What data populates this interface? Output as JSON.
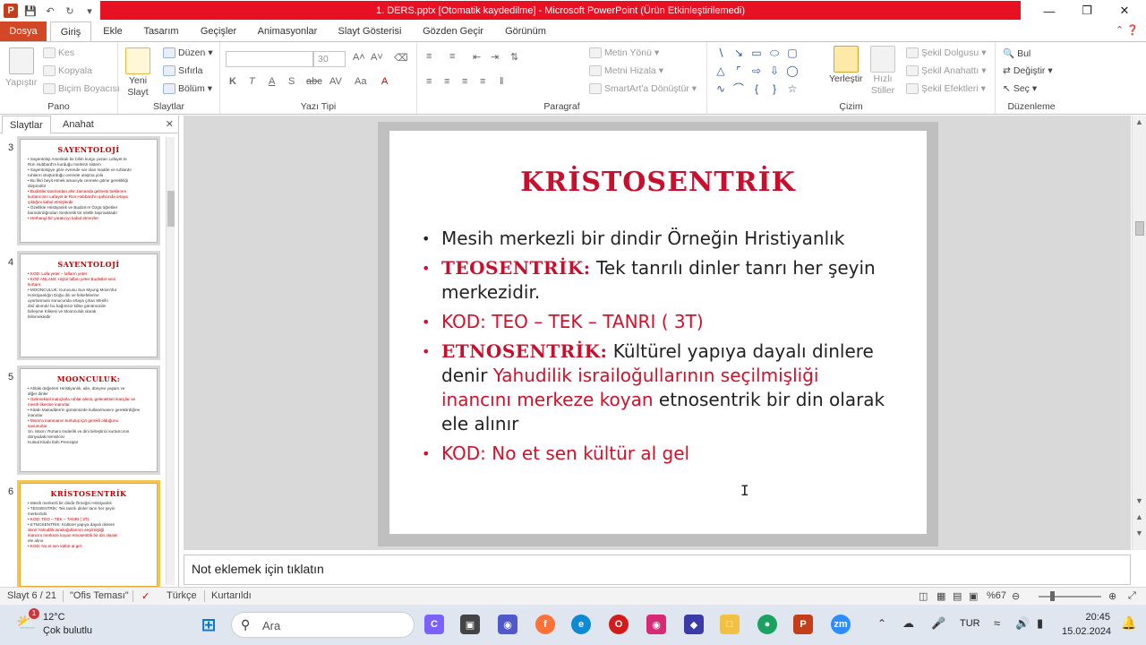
{
  "window": {
    "title": "1. DERS.pptx [Otomatik kaydedilme] - Microsoft PowerPoint (Ürün Etkinleştirilemedi)",
    "title_bar_color": "#e81123"
  },
  "ribbon_tabs": [
    "Dosya",
    "Giriş",
    "Ekle",
    "Tasarım",
    "Geçişler",
    "Animasyonlar",
    "Slayt Gösterisi",
    "Gözden Geçir",
    "Görünüm"
  ],
  "ribbon": {
    "pano": {
      "label": "Pano",
      "yapistir": "Yapıştır",
      "kes": "Kes",
      "kopyala": "Kopyala",
      "bicim": "Biçim Boyacısı"
    },
    "slaytlar": {
      "label": "Slaytlar",
      "yeni": "Yeni",
      "slayt": "Slayt",
      "duzen": "Düzen",
      "sifirla": "Sıfırla",
      "bolum": "Bölüm"
    },
    "yazi": {
      "label": "Yazı Tipi",
      "font_placeholder": "",
      "size": "30"
    },
    "paragraf": {
      "label": "Paragraf",
      "metin_yonu": "Metin Yönü",
      "metni_hizala": "Metni Hizala",
      "smartart": "SmartArt'a Dönüştür"
    },
    "cizim": {
      "label": "Çizim",
      "yerlestir": "Yerleştir",
      "hizli": "Hızlı",
      "stiller": "Stiller",
      "dolgu": "Şekil Dolgusu",
      "anahat": "Şekil Anahattı",
      "efekt": "Şekil Efektleri"
    },
    "duzenleme": {
      "label": "Düzenleme",
      "bul": "Bul",
      "degistir": "Değiştir",
      "sec": "Seç"
    }
  },
  "left_panel": {
    "tabs": [
      "Slaytlar",
      "Anahat"
    ],
    "slides": [
      {
        "num": "3",
        "title": "SAYENTOLOJİ",
        "lines": [
          {
            "t": "• Sayentoloji Amerikalı bir bilim kurgu yazarı Lafayet te",
            "red": false
          },
          {
            "t": "  Ron Hubbard'ın kurduğu merkezi sistem",
            "red": false
          },
          {
            "t": "• Sayentolojiye göre evrende var olan madde ve ruhlardır",
            "red": false
          },
          {
            "t": "  ruhların oluşturduğu cennete ulaşma yolu",
            "red": false
          },
          {
            "t": "• Bu fikri beyit etmek amacıyla cennete gitme gerekliliği",
            "red": false
          },
          {
            "t": "  düşünülür",
            "red": false
          },
          {
            "t": "• Budistler tanrılardan ahir zamanda gelmesi beklenen",
            "red": true
          },
          {
            "t": "  kurtarıcının Lafayet te Ron Hubbard'ın şahsında ortaya",
            "red": true
          },
          {
            "t": "  çıktığını kabul etmişlerdir",
            "red": true
          },
          {
            "t": "• Özellikle Hristiyanlık ve Budizm'e Özgü öğretiler",
            "red": false
          },
          {
            "t": "  barındırdığından Senkretik bir nitelik taşımaktadır",
            "red": false
          },
          {
            "t": "• Herhangi bir yaratıcıyı kabul etmezler",
            "red": true
          }
        ]
      },
      {
        "num": "4",
        "title": "SAYENTOLOJİ",
        "lines": [
          {
            "t": "• KOD: Lafa yeter – lafların yeter",
            "red": true
          },
          {
            "t": "• KOD ANLAMI: Hiçbir lafları yeter Budistler seni",
            "red": true
          },
          {
            "t": "  kurtarır",
            "red": true
          },
          {
            "t": "• MOONCULUK: Kurucusu Sun Myung Moon'dur",
            "red": false
          },
          {
            "t": "  Hıristiyanlığın Doğu din ve felsefelerine",
            "red": false
          },
          {
            "t": "  uyarlanması sonucunda ortaya çıkan Mesihi",
            "red": false
          },
          {
            "t": "  dinî akımdır bu bağımsız kilise günümüzde",
            "red": false
          },
          {
            "t": "  birleşme Kilisesi ve Moonculuk olarak",
            "red": false
          },
          {
            "t": "  bilinmektedir",
            "red": false
          }
        ]
      },
      {
        "num": "5",
        "title": "MOONCULUK:",
        "lines": [
          {
            "t": "• Ahlaki değerleri Hıristiyanlık, aile, dünyevi yaşam ve",
            "red": false
          },
          {
            "t": "  diğer dinler",
            "red": false
          },
          {
            "t": "• Geleneksel inançlarla ruhlar alemi, geleneksel inançlar ve",
            "red": true
          },
          {
            "t": "  mesih ilkesine inanırlar",
            "red": true
          },
          {
            "t": "• Kitabı Mukaddes'in günümüzde kullanılmasını gerektirdiğine",
            "red": false
          },
          {
            "t": "  inanırlar",
            "red": false
          },
          {
            "t": "• Moon'a inanmanın kurtuluş için gerekli olduğunu",
            "red": true
          },
          {
            "t": "  savunurlar",
            "red": true
          },
          {
            "t": "  Sn. Moon: Ruhani önderlik ve dini birleştirici kurtarıcının",
            "red": false
          },
          {
            "t": "  dünyadaki temsilcisi",
            "red": false
          },
          {
            "t": "  Kutsal Kitabı İlahi Prensiptir",
            "red": false
          }
        ]
      },
      {
        "num": "6",
        "title": "KRİSTOSENTRİK",
        "lines": [
          {
            "t": "• Mesih merkezli bir dindir Örneğin Hristiyanlık",
            "red": false
          },
          {
            "t": "• TEOSENTRİK: Tek tanrılı dinler tanrı her şeyin",
            "red": false
          },
          {
            "t": "  merkezidir.",
            "red": false
          },
          {
            "t": "• KOD: TEO – TEK – TANRI ( 3T)",
            "red": true
          },
          {
            "t": "• ETNOSENTRİK: Kültürel yapıya dayalı dinlere",
            "red": false
          },
          {
            "t": "  denir Yahudilik israiloğullarının seçilmişliği",
            "red": true
          },
          {
            "t": "  inancını merkeze koyan etnosentrik bir din olarak",
            "red": true
          },
          {
            "t": "  ele alınır",
            "red": false
          },
          {
            "t": "• KOD: No et sen kültür al gel",
            "red": true
          }
        ]
      }
    ]
  },
  "slide": {
    "title": "KRİSTOSENTRİK",
    "b1": "Mesih merkezli bir dindir Örneğin Hristiyanlık",
    "b2_term": "TEOSENTRİK:",
    "b2_rest_1": " Tek tanrılı dinler tanrı her şeyin",
    "b2_rest_2": "merkezidir.",
    "b3": "KOD: TEO – TEK – TANRI ( 3T)",
    "b4_term": "ETNOSENTRİK:",
    "b4_rest_1": " Kültürel yapıya dayalı dinlere",
    "b4_denir": "denir ",
    "b4_red_1": "Yahudilik israiloğullarının seçilmişliği",
    "b4_red_2": "inancını merkeze koyan",
    "b4_rest_2": " etnosentrik bir din olarak",
    "b4_rest_3": "ele alınır",
    "b5": "KOD: No et sen kültür al gel",
    "accent_color": "#c8102e"
  },
  "notes": {
    "placeholder": "Not eklemek için tıklatın"
  },
  "status": {
    "slide": "Slayt 6 / 21",
    "theme": "\"Ofis Teması\"",
    "lang": "Türkçe",
    "saved": "Kurtarıldı",
    "zoom": "%67"
  },
  "taskbar": {
    "temp": "12°C",
    "weather": "Çok bulutlu",
    "search": "Ara",
    "lang": "TUR",
    "time": "20:45",
    "date": "15.02.2024",
    "weather_badge": "1"
  }
}
